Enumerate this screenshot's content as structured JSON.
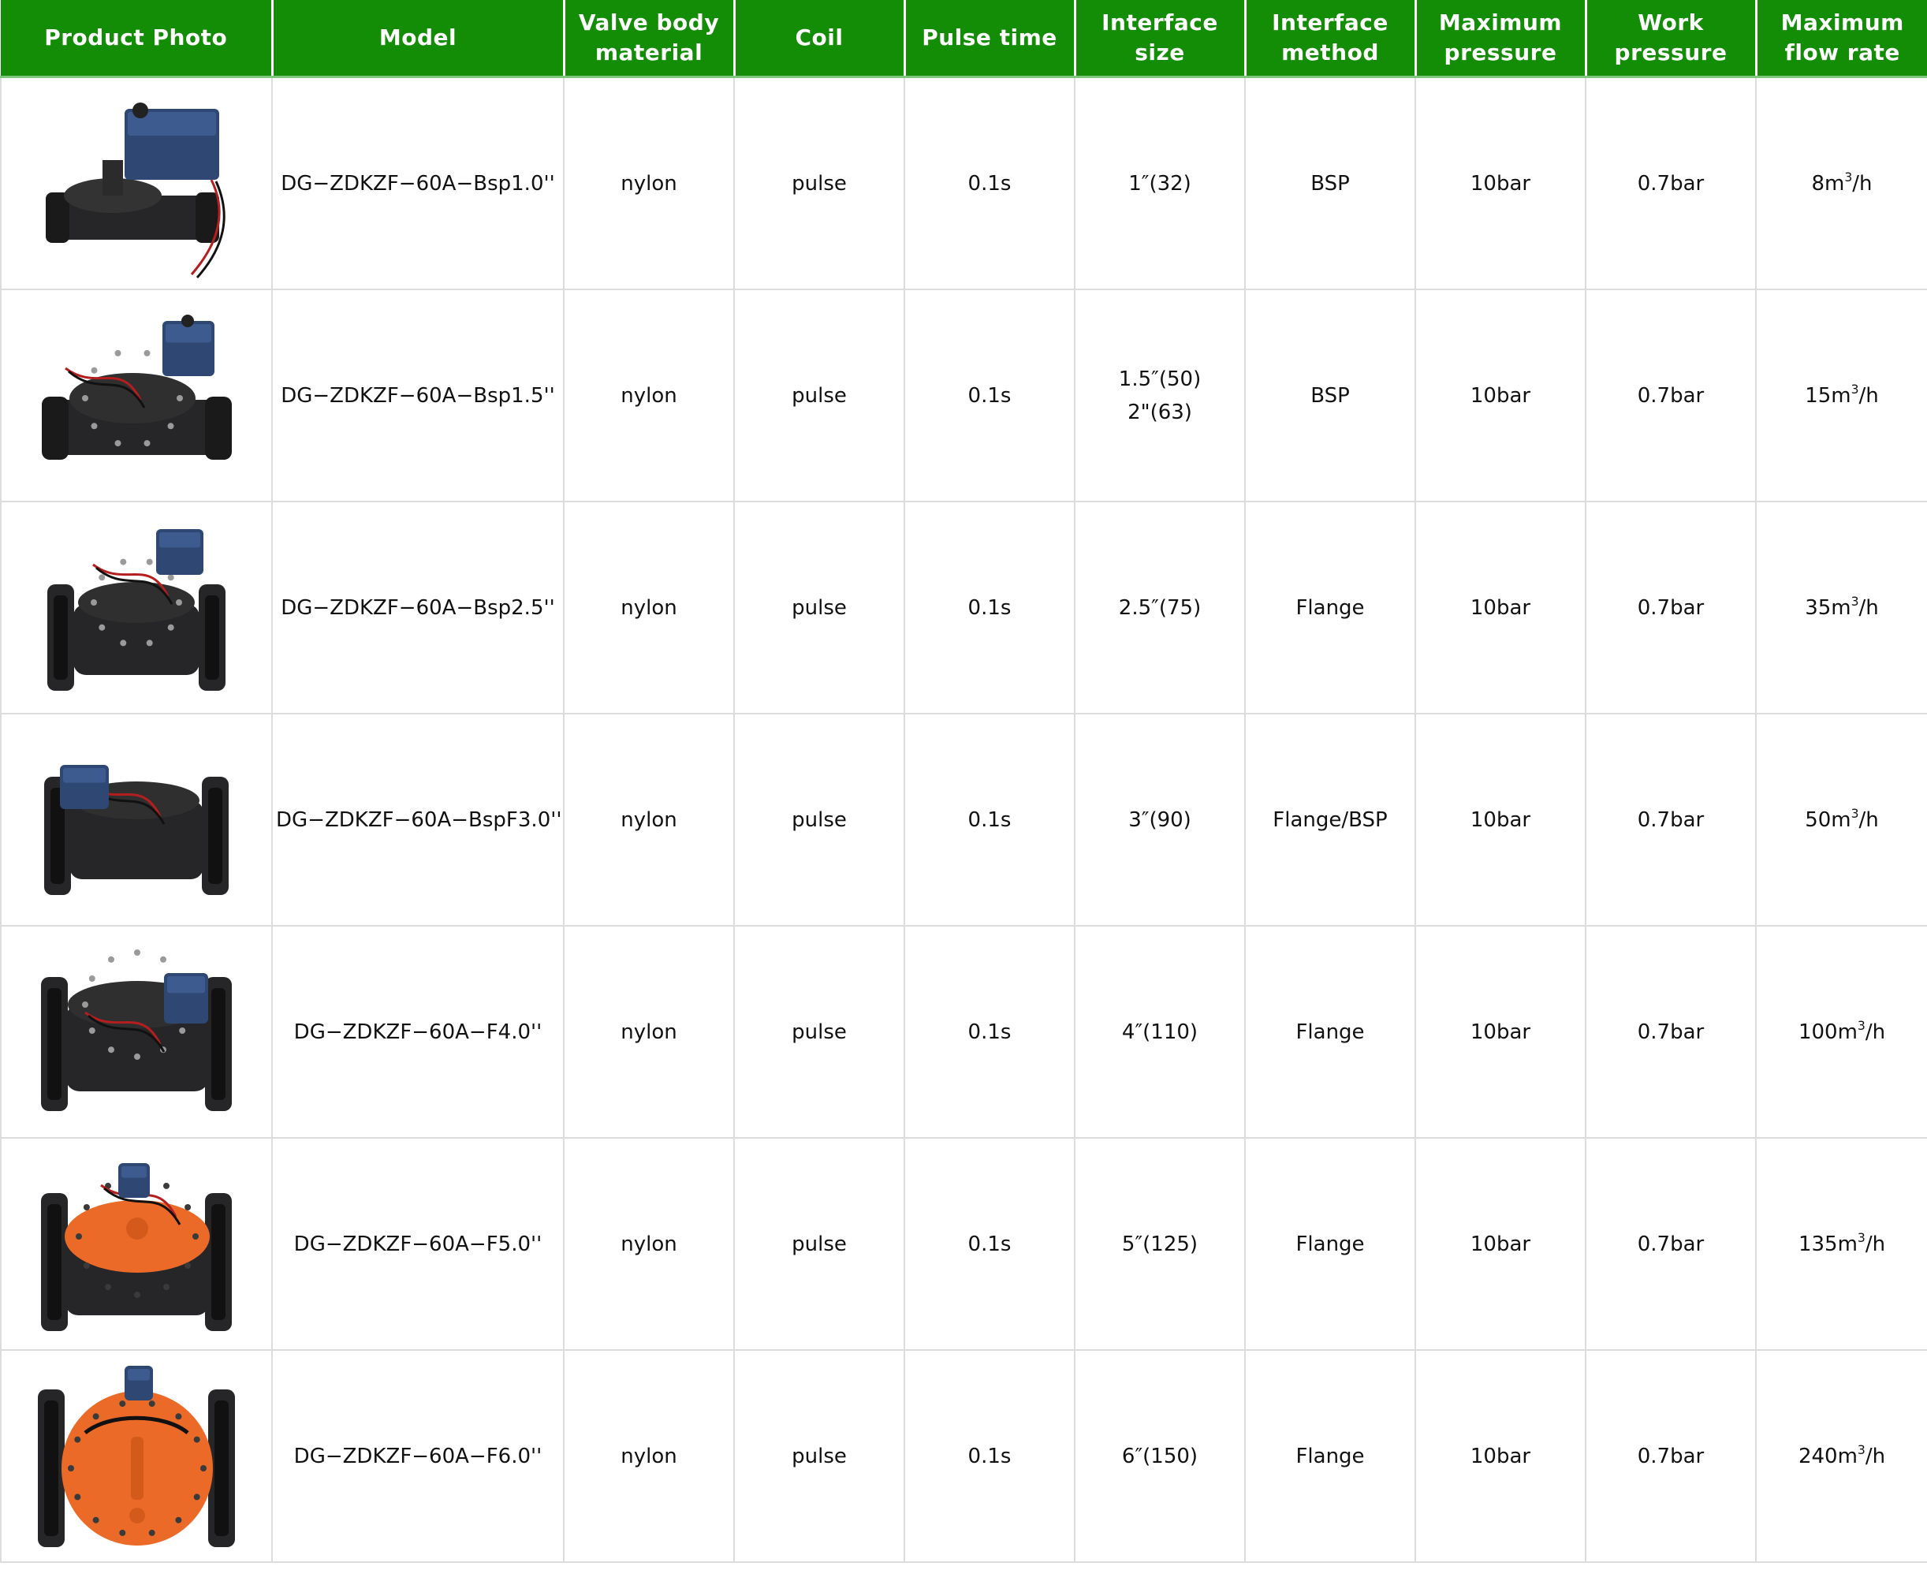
{
  "headers": [
    "Product Photo",
    "Model",
    "Valve body material",
    "Coil",
    "Pulse time",
    "Interface size",
    "Interface method",
    "Maximum pressure",
    "Work pressure",
    "Maximum flow rate"
  ],
  "rows": [
    {
      "model": "DG−ZDKZF−60A−Bsp1.0''",
      "material": "nylon",
      "coil": "pulse",
      "pulse": "0.1s",
      "size": [
        "1″(32)"
      ],
      "method": "BSP",
      "maxp": "10bar",
      "workp": "0.7bar",
      "flow_num": "8m",
      "flow_sup": "3",
      "flow_unit": "/h"
    },
    {
      "model": "DG−ZDKZF−60A−Bsp1.5''",
      "material": "nylon",
      "coil": "pulse",
      "pulse": "0.1s",
      "size": [
        "1.5″(50)",
        "2\"(63)"
      ],
      "method": "BSP",
      "maxp": "10bar",
      "workp": "0.7bar",
      "flow_num": "15m",
      "flow_sup": "3",
      "flow_unit": "/h"
    },
    {
      "model": "DG−ZDKZF−60A−Bsp2.5''",
      "material": "nylon",
      "coil": "pulse",
      "pulse": "0.1s",
      "size": [
        "2.5″(75)"
      ],
      "method": "Flange",
      "maxp": "10bar",
      "workp": "0.7bar",
      "flow_num": "35m",
      "flow_sup": "3",
      "flow_unit": "/h"
    },
    {
      "model": "DG−ZDKZF−60A−BspF3.0''",
      "material": "nylon",
      "coil": "pulse",
      "pulse": "0.1s",
      "size": [
        "3″(90)"
      ],
      "method": "Flange/BSP",
      "maxp": "10bar",
      "workp": "0.7bar",
      "flow_num": "50m",
      "flow_sup": "3",
      "flow_unit": "/h"
    },
    {
      "model": "DG−ZDKZF−60A−F4.0''",
      "material": "nylon",
      "coil": "pulse",
      "pulse": "0.1s",
      "size": [
        "4″(110)"
      ],
      "method": "Flange",
      "maxp": "10bar",
      "workp": "0.7bar",
      "flow_num": "100m",
      "flow_sup": "3",
      "flow_unit": "/h"
    },
    {
      "model": "DG−ZDKZF−60A−F5.0''",
      "material": "nylon",
      "coil": "pulse",
      "pulse": "0.1s",
      "size": [
        "5″(125)"
      ],
      "method": "Flange",
      "maxp": "10bar",
      "workp": "0.7bar",
      "flow_num": "135m",
      "flow_sup": "3",
      "flow_unit": "/h"
    },
    {
      "model": "DG−ZDKZF−60A−F6.0''",
      "material": "nylon",
      "coil": "pulse",
      "pulse": "0.1s",
      "size": [
        "6″(150)"
      ],
      "method": "Flange",
      "maxp": "10bar",
      "workp": "0.7bar",
      "flow_num": "240m",
      "flow_sup": "3",
      "flow_unit": "/h"
    }
  ],
  "colors": {
    "header_bg": "#138d05",
    "header_text": "#ffffff",
    "grid": "#dcdcdc",
    "valve_body": "#262628",
    "solenoid": "#2e4773",
    "valve_cover_orange": "#ec6a28"
  },
  "icons": [
    "solenoid-valve-1in",
    "solenoid-valve-1-5in",
    "solenoid-valve-2-5in",
    "solenoid-valve-3in",
    "solenoid-valve-4in",
    "solenoid-valve-5in",
    "solenoid-valve-6in"
  ]
}
